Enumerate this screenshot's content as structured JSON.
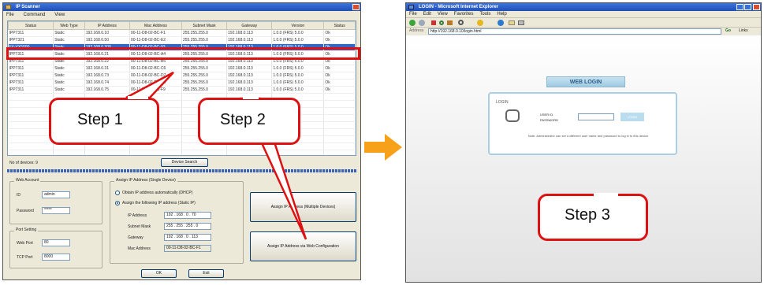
{
  "ip_scanner": {
    "title": "IP Scanner",
    "menu": [
      "File",
      "Command",
      "View"
    ],
    "columns": [
      "Status",
      "Web Type",
      "IP Address",
      "Mac Address",
      "Subnet Mask",
      "Gateway",
      "Version",
      "Status"
    ],
    "rows": [
      [
        "IPP7311",
        "Static",
        "192.168.0.10",
        "00-11-D8-02-BC-F1",
        "255.255.255.0",
        "192.168.0.113",
        "1.0.0 (FRS) 5.0.0",
        "Ok"
      ],
      [
        "IPP7321",
        "Static",
        "192.168.0.50",
        "00-11-D8-02-BC-E2",
        "255.255.255.0",
        "192.168.0.113",
        "1.0.0 (FRS) 5.0.0",
        "Ok"
      ],
      [
        "FX-VX5000",
        "Static",
        "192.168.0.200",
        "00-11-D8-02-BC-93",
        "255.255.255.0",
        "192.168.0.113",
        "1.0.0 (FRS) 5.0.0",
        "Ok"
      ],
      [
        "IPP7311",
        "Static",
        "192.168.0.21",
        "00-11-D8-02-BC-A4",
        "255.255.255.0",
        "192.168.0.113",
        "1.0.0 (FRS) 5.0.0",
        "Ok"
      ],
      [
        "IPP7311",
        "Static",
        "192.168.0.22",
        "00-11-D8-02-BC-B5",
        "255.255.255.0",
        "192.168.0.113",
        "1.0.0 (FRS) 5.0.0",
        "Ok"
      ],
      [
        "IPP7311",
        "Static",
        "192.168.0.31",
        "00-11-D8-02-BC-C6",
        "255.255.255.0",
        "192.168.0.113",
        "1.0.0 (FRS) 5.0.0",
        "Ok"
      ],
      [
        "IPP7311",
        "Static",
        "192.168.0.73",
        "00-11-D8-02-BC-D7",
        "255.255.255.0",
        "192.168.0.113",
        "1.0.0 (FRS) 5.0.0",
        "Ok"
      ],
      [
        "IPP7311",
        "Static",
        "192.168.0.74",
        "00-11-D8-02-BC-E8",
        "255.255.255.0",
        "192.168.0.113",
        "1.0.0 (FRS) 5.0.0",
        "Ok"
      ],
      [
        "IPP7311",
        "Static",
        "192.168.0.75",
        "00-11-D8-02-BC-F9",
        "255.255.255.0",
        "192.168.0.113",
        "1.0.0 (FRS) 5.0.0",
        "Ok"
      ]
    ],
    "device_count": "No of devices:  9",
    "device_search_button": "Device Search",
    "admin_group": "Web Account",
    "id_label": "ID",
    "id_value": "admin",
    "password_label": "Password",
    "password_value": "*****",
    "port_group": "Port Setting",
    "web_port_label": "Web Port",
    "web_port_value": "80",
    "tcp_port_label": "TCP Port",
    "tcp_port_value": "8000",
    "assign_group": "Assign IP Address (Single Device)",
    "radio_auto": "Obtain IP address automatically (DHCP)",
    "radio_static": "Assign the following IP address (Static IP)",
    "ip_label": "IP Address",
    "ip_value": "192 . 168 . 0 . 70",
    "mask_label": "Subnet Mask",
    "mask_value": "255 . 255 . 255 . 0",
    "gw_label": "Gateway",
    "gw_value": "192 . 168 . 0 . 113",
    "mac_label": "Mac Address",
    "mac_value": "00-11-D8-02-BC-F1",
    "assign_multi_button": "Assign IP Address (Multiple Devices)",
    "assign_web_button": "Assign IP Address via Web Configuration",
    "ok_button": "OK",
    "exit_button": "Exit"
  },
  "browser": {
    "title": "LOGIN - Microsoft Internet Explorer",
    "menu": [
      "File",
      "Edit",
      "View",
      "Favorites",
      "Tools",
      "Help"
    ],
    "address_label": "Address",
    "address_value": "http://192.168.0.10/login.html",
    "go_label": "Go",
    "links_label": "Links",
    "web_login_title": "WEB LOGIN",
    "login_heading": "LOGIN",
    "user_label": "USER ID",
    "password_label": "PASSWORD",
    "login_button": "LOGIN",
    "note": "Note: Administrator can set a different user name and password to log in to this device"
  },
  "callouts": {
    "step1": "Step 1",
    "step2": "Step 2",
    "step3": "Step 3"
  },
  "colors": {
    "callout_border": "#dd1111",
    "arrow": "#f7a11a",
    "xp_title": "#245edb",
    "login_banner": "#a8cfe6"
  }
}
